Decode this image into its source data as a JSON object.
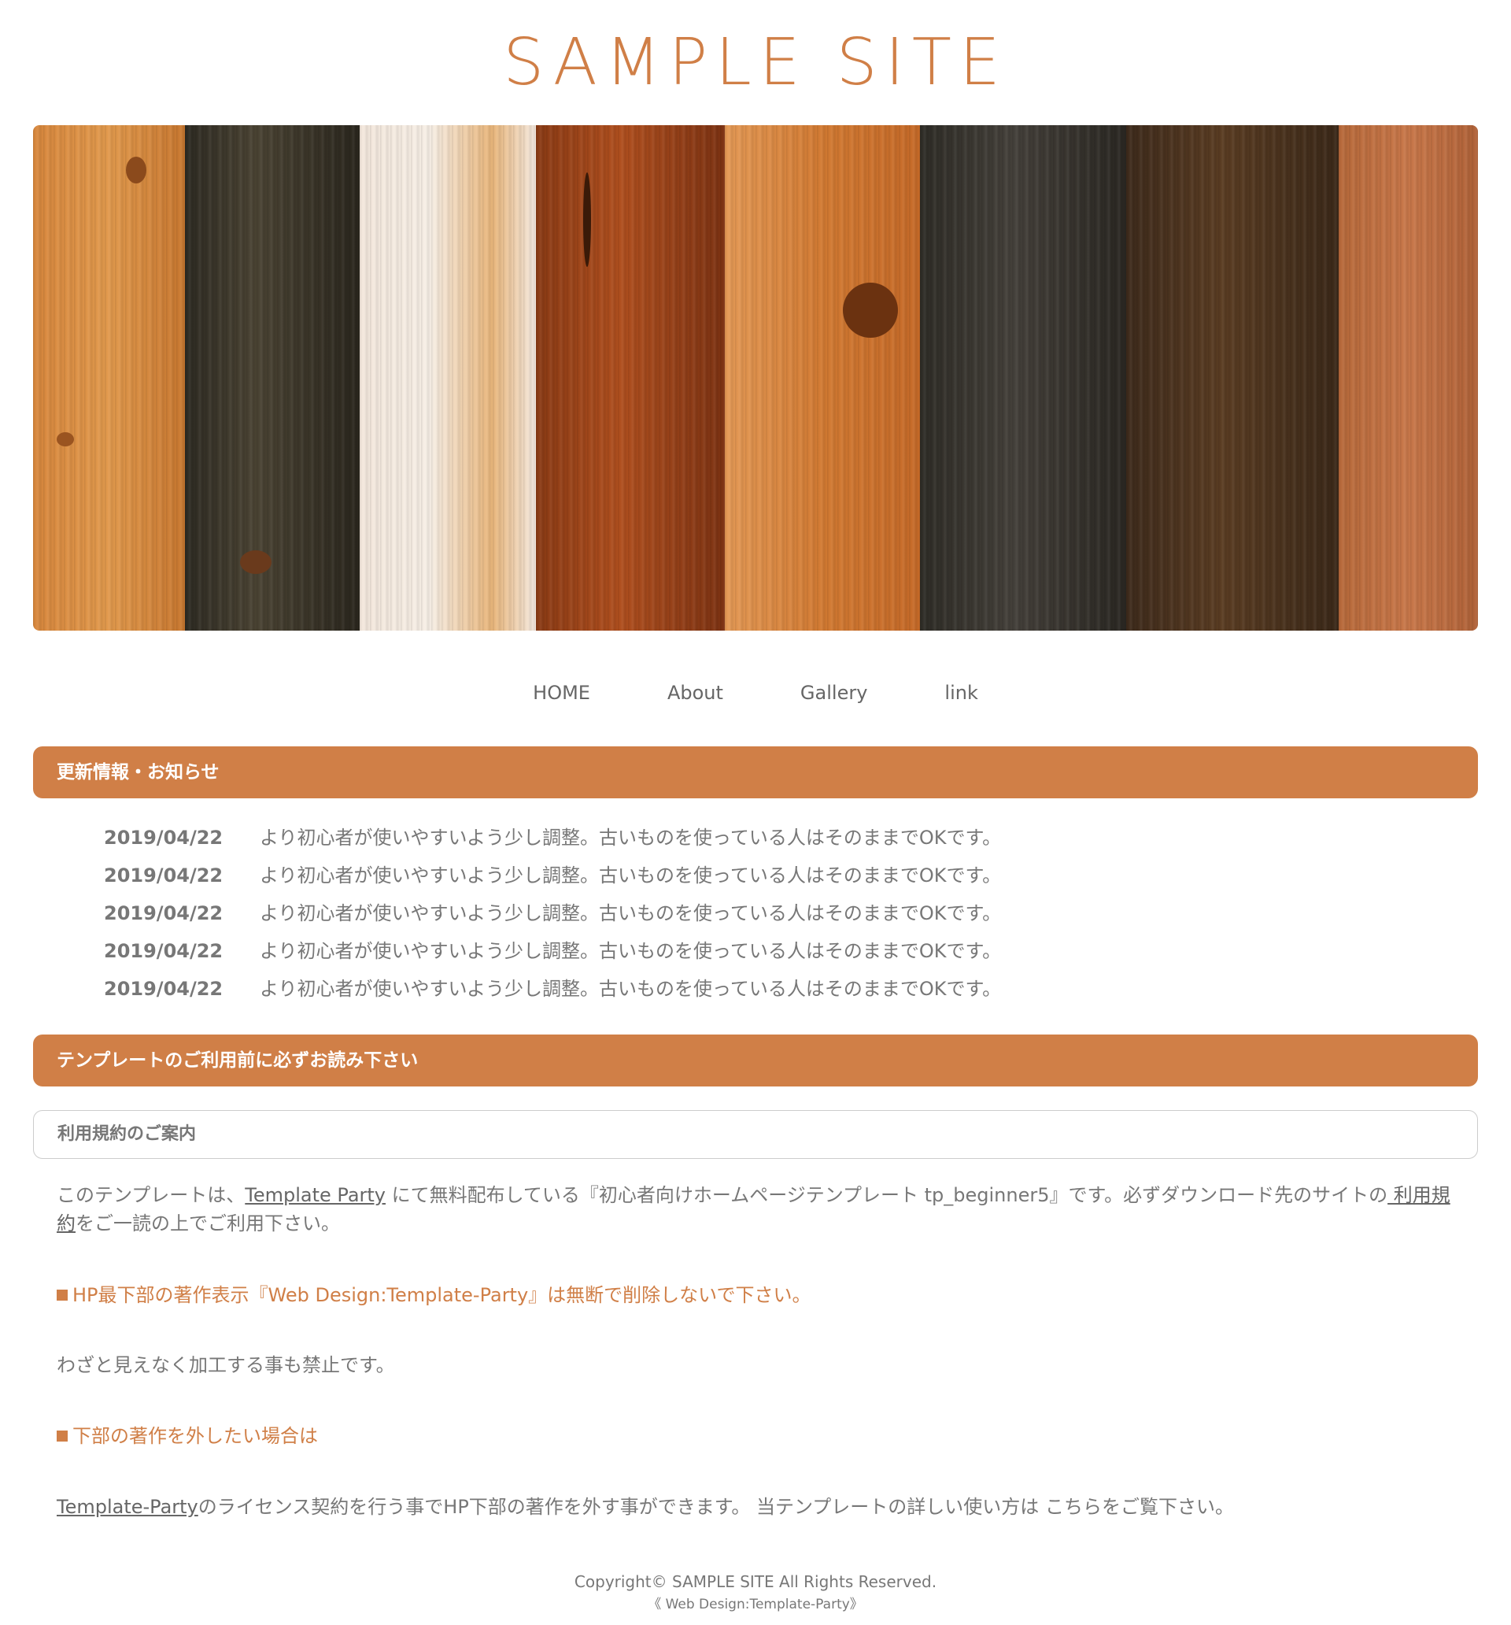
{
  "header": {
    "site_title": "SAMPLE SITE"
  },
  "hero": {
    "image_name": "wood-planks-image"
  },
  "nav": {
    "items": [
      {
        "label": "HOME"
      },
      {
        "label": "About"
      },
      {
        "label": "Gallery"
      },
      {
        "label": "link"
      }
    ]
  },
  "news": {
    "heading": "更新情報・お知らせ",
    "items": [
      {
        "date": "2019/04/22",
        "text": "より初心者が使いやすいよう少し調整。古いものを使っている人はそのままでOKです。"
      },
      {
        "date": "2019/04/22",
        "text": "より初心者が使いやすいよう少し調整。古いものを使っている人はそのままでOKです。"
      },
      {
        "date": "2019/04/22",
        "text": "より初心者が使いやすいよう少し調整。古いものを使っている人はそのままでOKです。"
      },
      {
        "date": "2019/04/22",
        "text": "より初心者が使いやすいよう少し調整。古いものを使っている人はそのままでOKです。"
      },
      {
        "date": "2019/04/22",
        "text": "より初心者が使いやすいよう少し調整。古いものを使っている人はそのままでOKです。"
      }
    ]
  },
  "notice": {
    "heading": "テンプレートのご利用前に必ずお読み下さい",
    "subheading": "利用規約のご案内",
    "intro_pre": "このテンプレートは、",
    "intro_link1": "Template Party",
    "intro_mid": " にて無料配布している『初心者向けホームページテンプレート tp_beginner5』です。必ずダウンロード先のサイトの",
    "intro_link2": " 利用規約",
    "intro_post": "をご一読の上でご利用下さい。",
    "rule1": "HP最下部の著作表示『Web Design:Template-Party』は無断で削除しないで下さい。",
    "rule1_note": "わざと見えなく加工する事も禁止です。",
    "rule2": "下部の著作を外したい場合は",
    "license_link": "Template-Party",
    "license_text": "のライセンス契約を行う事でHP下部の著作を外す事ができます。 当テンプレートの詳しい使い方は こちらをご覧下さい。"
  },
  "footer": {
    "copyright": "Copyright© SAMPLE SITE All Rights Reserved.",
    "credit": "《 Web Design:Template-Party》"
  },
  "colors": {
    "accent": "#d07f47",
    "text": "#777777",
    "border": "#cccccc"
  }
}
